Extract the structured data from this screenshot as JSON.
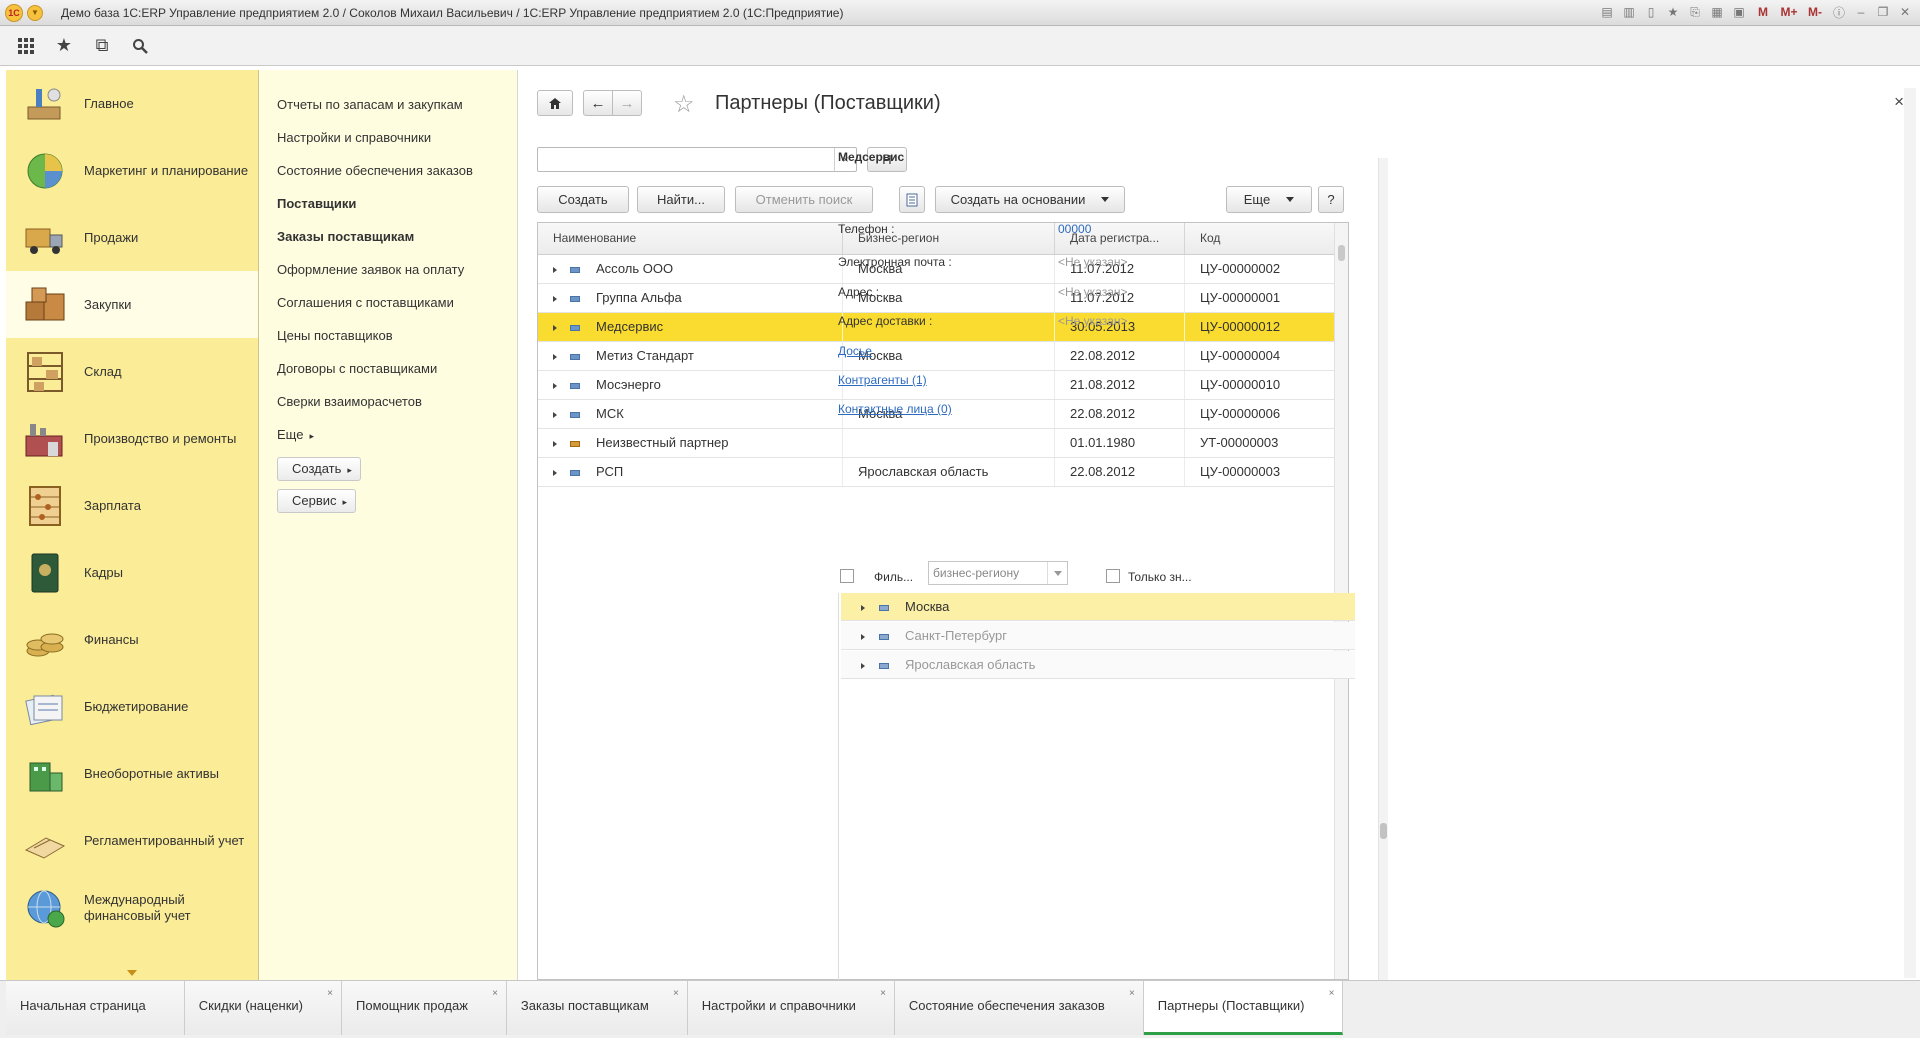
{
  "window": {
    "title": "Демо база 1С:ERP Управление предприятием 2.0 / Соколов Михаил Васильевич / 1С:ERP Управление предприятием 2.0  (1С:Предприятие)",
    "m_labels": [
      "M",
      "M+",
      "M-"
    ]
  },
  "sections": [
    {
      "label": "Главное",
      "icon": "home-desk-icon"
    },
    {
      "label": "Маркетинг и планирование",
      "icon": "pie-chart-icon"
    },
    {
      "label": "Продажи",
      "icon": "truck-icon"
    },
    {
      "label": "Закупки",
      "icon": "boxes-icon"
    },
    {
      "label": "Склад",
      "icon": "shelves-icon"
    },
    {
      "label": "Производство и ремонты",
      "icon": "factory-icon"
    },
    {
      "label": "Зарплата",
      "icon": "abacus-icon"
    },
    {
      "label": "Кадры",
      "icon": "passport-icon"
    },
    {
      "label": "Финансы",
      "icon": "coins-icon"
    },
    {
      "label": "Бюджетирование",
      "icon": "documents-icon"
    },
    {
      "label": "Внеоборотные активы",
      "icon": "building-icon"
    },
    {
      "label": "Регламентированный учет",
      "icon": "ledger-icon"
    },
    {
      "label": "Международный финансовый учет",
      "icon": "globe-money-icon"
    }
  ],
  "submenu": {
    "items": [
      {
        "label": "Отчеты по запасам и закупкам",
        "bold": false
      },
      {
        "label": "Настройки и справочники",
        "bold": false
      },
      {
        "label": "Состояние обеспечения заказов",
        "bold": false
      },
      {
        "label": "Поставщики",
        "bold": true
      },
      {
        "label": "Заказы поставщикам",
        "bold": true
      },
      {
        "label": "Оформление заявок на оплату",
        "bold": false
      },
      {
        "label": "Соглашения с поставщиками",
        "bold": false
      },
      {
        "label": "Цены поставщиков",
        "bold": false
      },
      {
        "label": "Договоры с поставщиками",
        "bold": false
      },
      {
        "label": "Сверки взаиморасчетов",
        "bold": false
      }
    ],
    "more_label": "Еще",
    "create_label": "Создать",
    "service_label": "Сервис"
  },
  "form": {
    "title": "Партнеры (Поставщики)",
    "search_value": "",
    "search_button": "Н",
    "create_label": "Создать",
    "find_label": "Найти...",
    "cancel_search_label": "Отменить поиск",
    "create_based_label": "Создать на основании",
    "more_label": "Еще",
    "help_label": "?"
  },
  "table": {
    "columns": [
      "Наименование",
      "Бизнес-регион",
      "Дата регистра...",
      "Код"
    ],
    "rows": [
      {
        "name": "Ассоль ООО",
        "region": "Москва",
        "date": "11.07.2012",
        "code": "ЦУ-00000002",
        "selected": false,
        "special": false
      },
      {
        "name": "Группа Альфа",
        "region": "Москва",
        "date": "11.07.2012",
        "code": "ЦУ-00000001",
        "selected": false,
        "special": false
      },
      {
        "name": "Медсервис",
        "region": "",
        "date": "30.05.2013",
        "code": "ЦУ-00000012",
        "selected": true,
        "special": false
      },
      {
        "name": "Метиз Стандарт",
        "region": "Москва",
        "date": "22.08.2012",
        "code": "ЦУ-00000004",
        "selected": false,
        "special": false
      },
      {
        "name": "Мосэнерго",
        "region": "",
        "date": "21.08.2012",
        "code": "ЦУ-00000010",
        "selected": false,
        "special": false
      },
      {
        "name": "МСК",
        "region": "Москва",
        "date": "22.08.2012",
        "code": "ЦУ-00000006",
        "selected": false,
        "special": false
      },
      {
        "name": "Неизвестный партнер",
        "region": "",
        "date": "01.01.1980",
        "code": "УТ-00000003",
        "selected": false,
        "special": true
      },
      {
        "name": "РСП",
        "region": "Ярославская область",
        "date": "22.08.2012",
        "code": "ЦУ-00000003",
        "selected": false,
        "special": false
      }
    ]
  },
  "info": {
    "partner_name": "Медсервис",
    "phone_label": "Телефон :",
    "phone_value": "00000",
    "email_label": "Электронная почта :",
    "email_value": "<Не указан>",
    "address_label": "Адрес :",
    "address_value": "<Не указан>",
    "delivery_label": "Адрес доставки :",
    "delivery_value": "<Не указан>",
    "dossier_link": "Досье",
    "contractors_link": "Контрагенты (1)",
    "contacts_link": "Контактные лица (0)",
    "filter_label": "Филь...",
    "filter_select": "бизнес-региону",
    "only_label": "Только зн...",
    "regions": [
      {
        "label": "Москва",
        "active": true
      },
      {
        "label": "Санкт-Петербург",
        "active": false
      },
      {
        "label": "Ярославская область",
        "active": false
      }
    ]
  },
  "tabs": [
    {
      "label": "Начальная страница",
      "closable": false,
      "active": false
    },
    {
      "label": "Скидки (наценки)",
      "closable": true,
      "active": false
    },
    {
      "label": "Помощник продаж",
      "closable": true,
      "active": false
    },
    {
      "label": "Заказы поставщикам",
      "closable": true,
      "active": false
    },
    {
      "label": "Настройки и справочники",
      "closable": true,
      "active": false
    },
    {
      "label": "Состояние обеспечения заказов",
      "closable": true,
      "active": false
    },
    {
      "label": "Партнеры (Поставщики)",
      "closable": true,
      "active": true
    }
  ],
  "colors": {
    "sections_bg": "#fbec98",
    "submenu_bg": "#fffde0",
    "selected_row": "#fadb2f",
    "active_tab_accent": "#2e9e47",
    "link": "#2d6bbf"
  }
}
